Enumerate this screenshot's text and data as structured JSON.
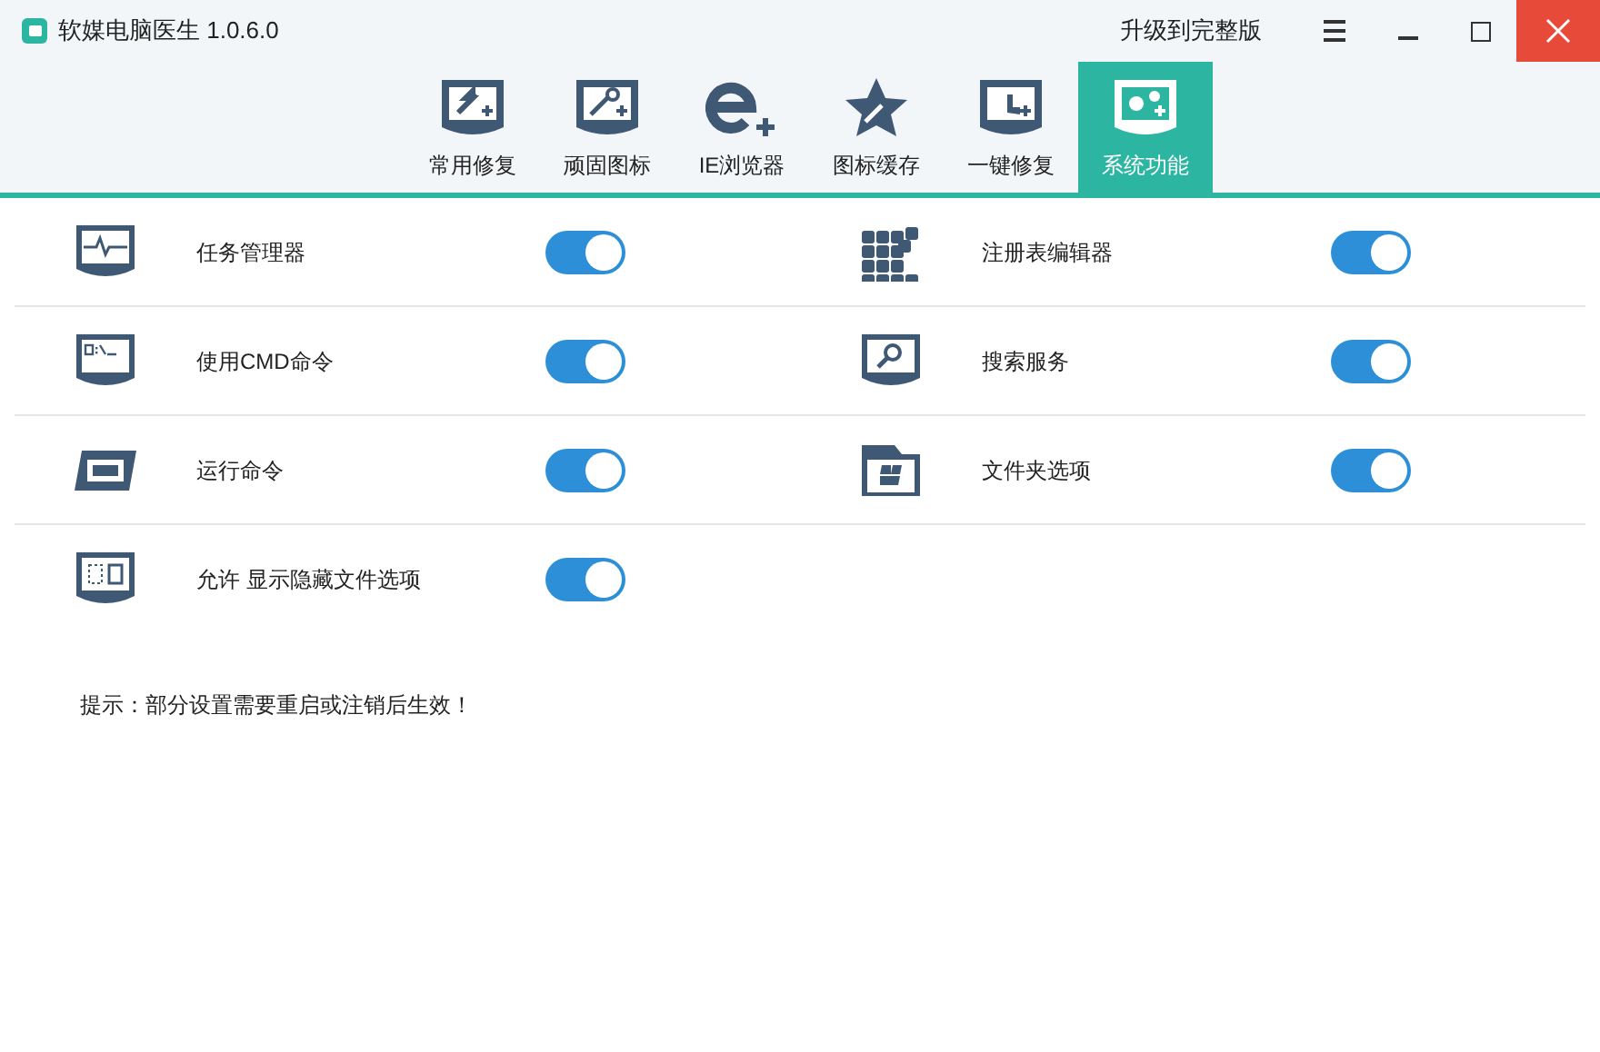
{
  "window": {
    "title": "软媒电脑医生 1.0.6.0",
    "upgrade": "升级到完整版"
  },
  "tabs": [
    {
      "label": "常用修复",
      "selected": false
    },
    {
      "label": "顽固图标",
      "selected": false
    },
    {
      "label": "IE浏览器",
      "selected": false
    },
    {
      "label": "图标缓存",
      "selected": false
    },
    {
      "label": "一键修复",
      "selected": false
    },
    {
      "label": "系统功能",
      "selected": true
    }
  ],
  "settings": [
    {
      "label": "任务管理器",
      "on": true
    },
    {
      "label": "注册表编辑器",
      "on": true
    },
    {
      "label": "使用CMD命令",
      "on": true
    },
    {
      "label": "搜索服务",
      "on": true
    },
    {
      "label": "运行命令",
      "on": true
    },
    {
      "label": "文件夹选项",
      "on": true
    },
    {
      "label": "允许 显示隐藏文件选项",
      "on": true
    }
  ],
  "hint": "提示：部分设置需要重启或注销后生效！"
}
